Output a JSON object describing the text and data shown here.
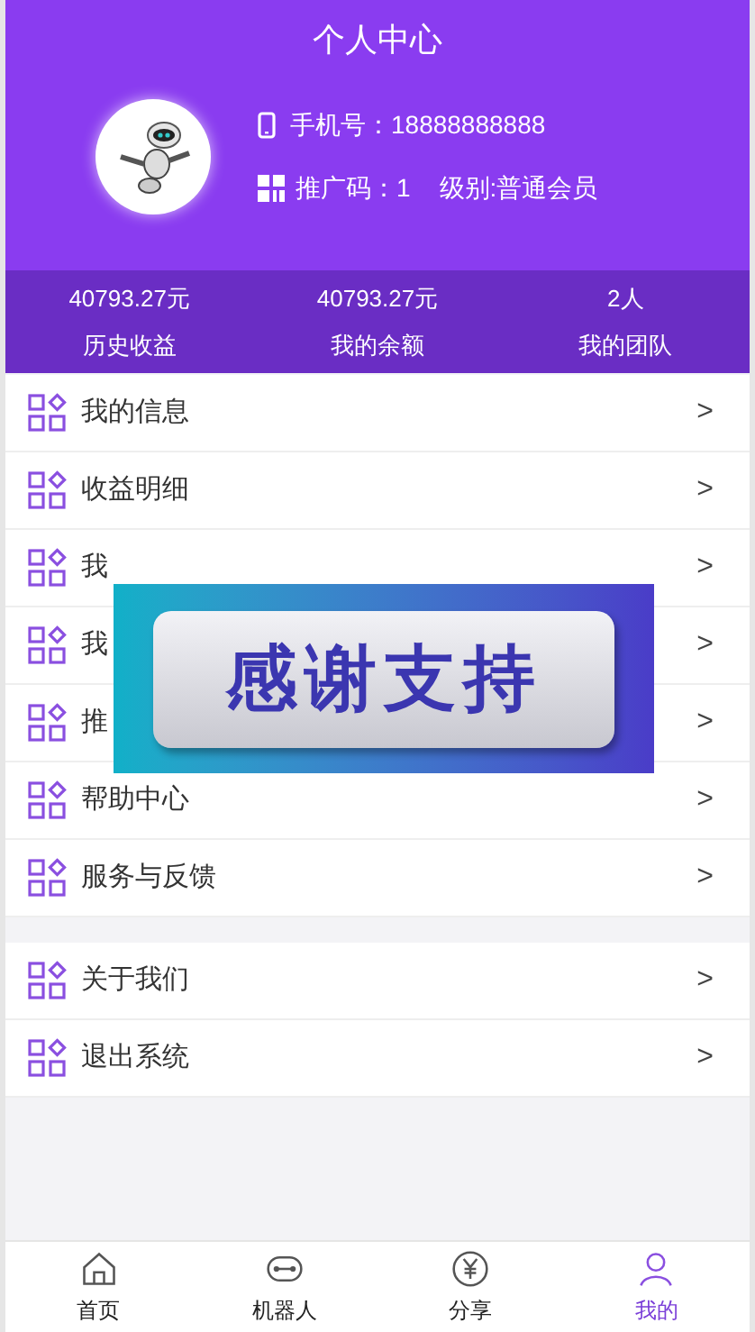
{
  "header": {
    "title": "个人中心",
    "phone_label": "手机号：",
    "phone": "18888888888",
    "invite_label": "推广码：",
    "invite_code": "1",
    "level_label": "级别:普通会员"
  },
  "stats": [
    {
      "value": "40793.27元",
      "label": "历史收益"
    },
    {
      "value": "40793.27元",
      "label": "我的余额"
    },
    {
      "value": "2人",
      "label": "我的团队"
    }
  ],
  "menu_groups": [
    [
      {
        "label": "我的信息",
        "arrow": ">"
      },
      {
        "label": "收益明细",
        "arrow": ">"
      },
      {
        "label": "我",
        "arrow": ">"
      },
      {
        "label": "我",
        "arrow": ">"
      },
      {
        "label": "推",
        "arrow": ">"
      },
      {
        "label": "帮助中心",
        "arrow": ">"
      },
      {
        "label": "服务与反馈",
        "arrow": ">"
      }
    ],
    [
      {
        "label": "关于我们",
        "arrow": ">"
      },
      {
        "label": "退出系统",
        "arrow": ">"
      }
    ]
  ],
  "overlay": {
    "text": "感谢支持"
  },
  "tab_bar": [
    {
      "kind": "home",
      "label": "首页",
      "selected": false
    },
    {
      "kind": "robot",
      "label": "机器人",
      "selected": false
    },
    {
      "kind": "share",
      "label": "分享",
      "selected": false
    },
    {
      "kind": "me",
      "label": "我的",
      "selected": true
    }
  ]
}
